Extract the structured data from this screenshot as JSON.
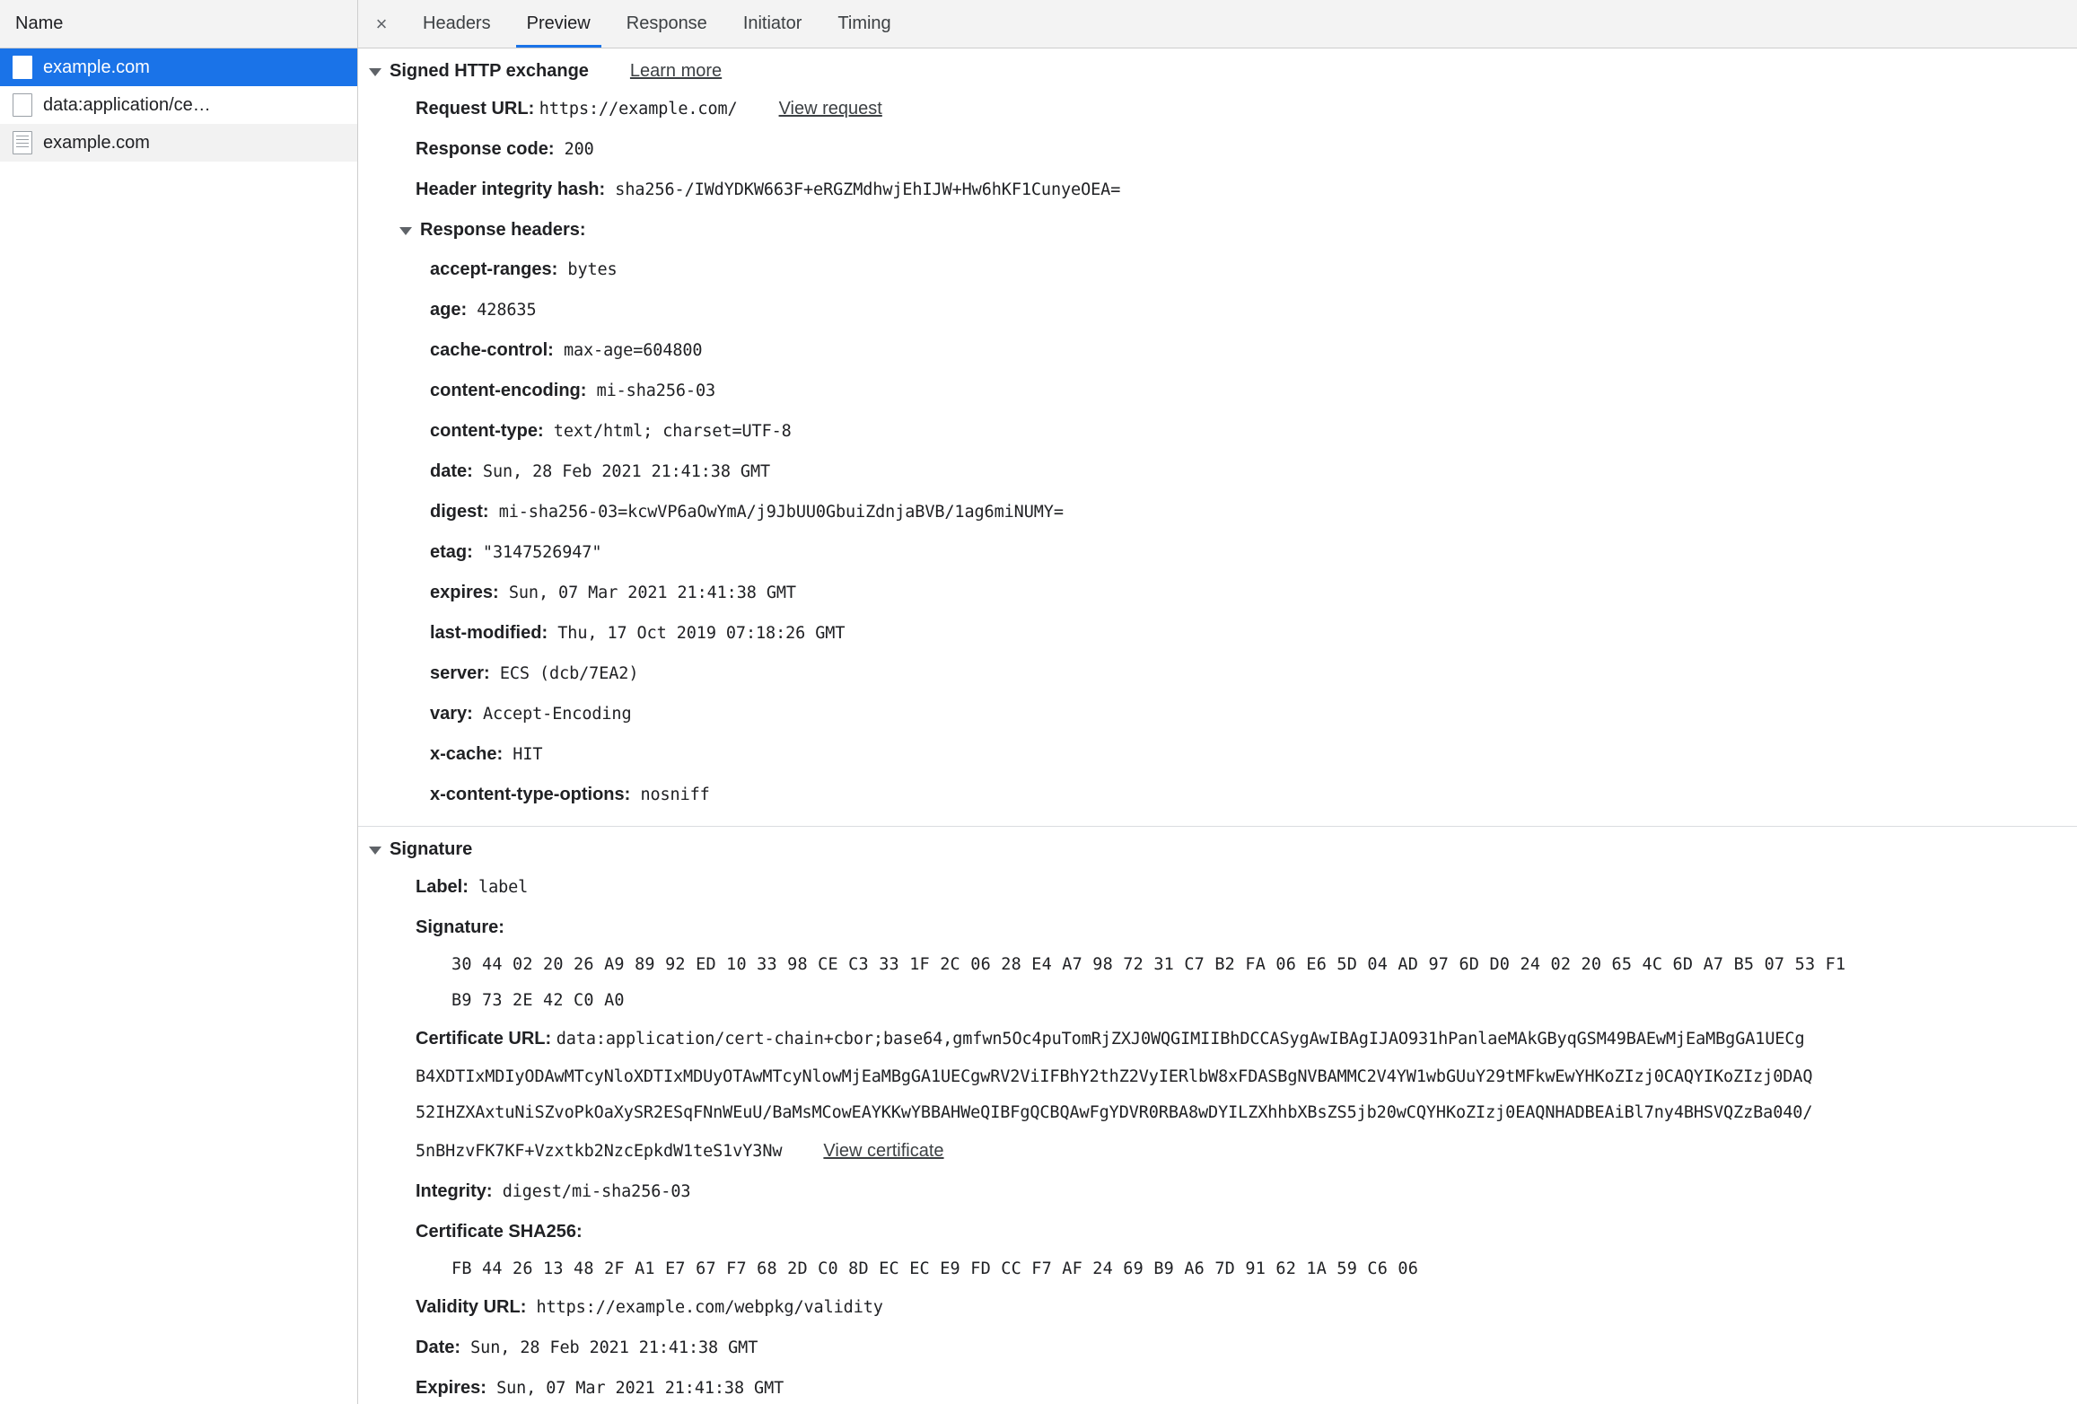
{
  "network_list": {
    "header": "Name",
    "items": [
      {
        "label": "example.com",
        "icon": "blank-file-icon",
        "selected": true
      },
      {
        "label": "data:application/ce…",
        "icon": "blank-file-icon",
        "selected": false
      },
      {
        "label": "example.com",
        "icon": "document-file-icon",
        "selected": false
      }
    ]
  },
  "detail": {
    "close_label": "×",
    "tabs": [
      {
        "label": "Headers",
        "active": false
      },
      {
        "label": "Preview",
        "active": true
      },
      {
        "label": "Response",
        "active": false
      },
      {
        "label": "Initiator",
        "active": false
      },
      {
        "label": "Timing",
        "active": false
      }
    ]
  },
  "sxg": {
    "section_title": "Signed HTTP exchange",
    "learn_more": "Learn more",
    "request_url_key": "Request URL:",
    "request_url_value": "https://example.com/",
    "view_request": "View request",
    "response_code_key": "Response code:",
    "response_code_value": "200",
    "header_integrity_key": "Header integrity hash:",
    "header_integrity_value": "sha256-/IWdYDKW663F+eRGZMdhwjEhIJW+Hw6hKF1CunyeOEA=",
    "response_headers_title": "Response headers:",
    "response_headers": [
      {
        "name": "accept-ranges:",
        "value": "bytes"
      },
      {
        "name": "age:",
        "value": "428635"
      },
      {
        "name": "cache-control:",
        "value": "max-age=604800"
      },
      {
        "name": "content-encoding:",
        "value": "mi-sha256-03"
      },
      {
        "name": "content-type:",
        "value": "text/html; charset=UTF-8"
      },
      {
        "name": "date:",
        "value": "Sun, 28 Feb 2021 21:41:38 GMT"
      },
      {
        "name": "digest:",
        "value": "mi-sha256-03=kcwVP6aOwYmA/j9JbUU0GbuiZdnjaBVB/1ag6miNUMY="
      },
      {
        "name": "etag:",
        "value": "\"3147526947\""
      },
      {
        "name": "expires:",
        "value": "Sun, 07 Mar 2021 21:41:38 GMT"
      },
      {
        "name": "last-modified:",
        "value": "Thu, 17 Oct 2019 07:18:26 GMT"
      },
      {
        "name": "server:",
        "value": "ECS (dcb/7EA2)"
      },
      {
        "name": "vary:",
        "value": "Accept-Encoding"
      },
      {
        "name": "x-cache:",
        "value": "HIT"
      },
      {
        "name": "x-content-type-options:",
        "value": "nosniff"
      }
    ]
  },
  "signature": {
    "section_title": "Signature",
    "label_key": "Label:",
    "label_value": "label",
    "signature_key": "Signature:",
    "signature_bytes_line1": "30 44 02 20 26 A9 89 92 ED 10 33 98 CE C3 33 1F 2C 06 28 E4 A7 98 72 31 C7 B2 FA 06 E6 5D 04 AD 97 6D D0 24 02 20 65 4C 6D A7 B5 07 53 F1",
    "signature_bytes_line2": "B9 73 2E 42 C0 A0",
    "certificate_url_key": "Certificate URL:",
    "certificate_url_line1": "data:application/cert-chain+cbor;base64,gmfwn5Oc4puTomRjZXJ0WQGIMIIBhDCCASygAwIBAgIJAO931hPanlaeMAkGByqGSM49BAEwMjEaMBgGA1UECg",
    "certificate_url_line2": "B4XDTIxMDIyODAwMTcyNloXDTIxMDUyOTAwMTcyNlowMjEaMBgGA1UECgwRV2ViIFBhY2thZ2VyIERlbW8xFDASBgNVBAMMC2V4YW1wbGUuY29tMFkwEwYHKoZIzj0CAQYIKoZIzj0DAQ",
    "certificate_url_line3": "52IHZXAxtuNiSZvoPkOaXySR2ESqFNnWEuU/BaMsMCowEAYKKwYBBAHWeQIBFgQCBQAwFgYDVR0RBA8wDYILZXhhbXBsZS5jb20wCQYHKoZIzj0EAQNHADBEAiBl7ny4BHSVQZzBa040/",
    "certificate_url_line4": "5nBHzvFK7KF+Vzxtkb2NzcEpkdW1teS1vY3Nw",
    "view_certificate": "View certificate",
    "integrity_key": "Integrity:",
    "integrity_value": "digest/mi-sha256-03",
    "cert_sha256_key": "Certificate SHA256:",
    "cert_sha256_bytes": "FB 44 26 13 48 2F A1 E7 67 F7 68 2D C0 8D EC EC E9 FD CC F7 AF 24 69 B9 A6 7D 91 62 1A 59 C6 06",
    "validity_url_key": "Validity URL:",
    "validity_url_value": "https://example.com/webpkg/validity",
    "date_key": "Date:",
    "date_value": "Sun, 28 Feb 2021 21:41:38 GMT",
    "expires_key": "Expires:",
    "expires_value": "Sun, 07 Mar 2021 21:41:38 GMT"
  },
  "colors": {
    "selection_blue": "#1a73e8",
    "tab_underline": "#1a73e8",
    "panel_gray": "#f3f3f3"
  }
}
